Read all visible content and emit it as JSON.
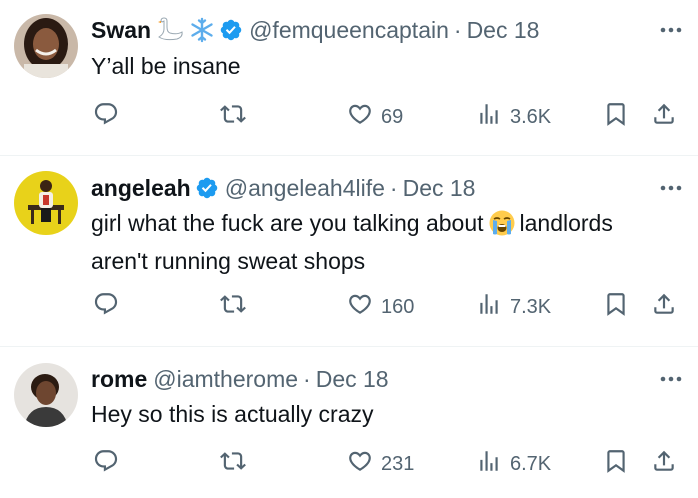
{
  "tweets": [
    {
      "name": "Swan",
      "name_emojis": [
        "swan",
        "snowflake"
      ],
      "verified": true,
      "handle": "@femqueencaptain",
      "separator": "·",
      "date": "Dec 18",
      "text_before": "Y’all be insane",
      "text_emoji": "",
      "text_after": "",
      "replies": "",
      "retweets": "",
      "likes": "69",
      "views": "3.6K"
    },
    {
      "name": "angeleah",
      "name_emojis": [],
      "verified": true,
      "handle": "@angeleah4life",
      "separator": "·",
      "date": "Dec 18",
      "text_before": "girl what the fuck are you talking about",
      "text_emoji": "loudly-crying-face",
      "text_after": "landlords aren't running sweat shops",
      "replies": "",
      "retweets": "",
      "likes": "160",
      "views": "7.3K"
    },
    {
      "name": "rome",
      "name_emojis": [],
      "verified": false,
      "handle": "@iamtherome",
      "separator": "·",
      "date": "Dec 18",
      "text_before": "Hey so this is actually crazy",
      "text_emoji": "",
      "text_after": "",
      "replies": "",
      "retweets": "",
      "likes": "231",
      "views": "6.7K"
    }
  ],
  "colors": {
    "text": "#0f1419",
    "secondary": "#536471",
    "verified": "#1d9bf0",
    "divider": "#eff3f4"
  },
  "icons": {
    "reply": "reply-icon",
    "retweet": "retweet-icon",
    "like": "heart-icon",
    "views": "views-icon",
    "bookmark": "bookmark-icon",
    "share": "share-icon",
    "more": "more-icon"
  }
}
